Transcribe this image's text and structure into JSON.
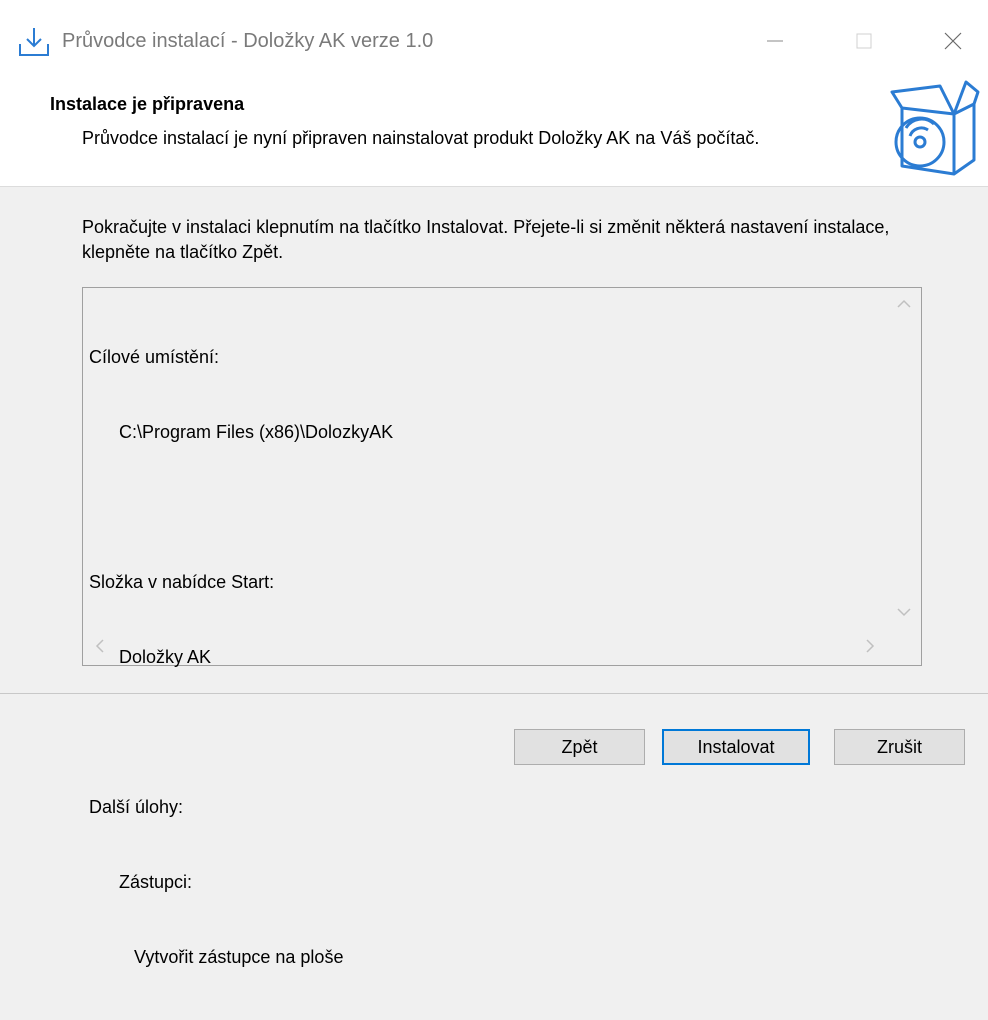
{
  "window": {
    "title": "Průvodce instalací - Doložky AK verze 1.0",
    "icons": {
      "app": "download-tray-icon",
      "minimize": "minimize-icon",
      "maximize": "maximize-icon",
      "close": "close-icon"
    }
  },
  "header": {
    "title": "Instalace je připravena",
    "description": "Průvodce instalací je nyní připraven nainstalovat produkt Doložky AK na Váš počítač.",
    "image_icon": "software-box-disc-icon"
  },
  "main": {
    "intro": "Pokračujte v instalaci klepnutím na tlačítko Instalovat. Přejete-li si změnit některá nastavení instalace, klepněte na tlačítko Zpět.",
    "memo_lines": [
      "Cílové umístění:",
      "      C:\\Program Files (x86)\\DolozkyAK",
      "",
      "Složka v nabídce Start:",
      "      Doložky AK",
      "",
      "Další úlohy:",
      "      Zástupci:",
      "         Vytvořit zástupce na ploše"
    ]
  },
  "buttons": {
    "back": "Zpět",
    "install": "Instalovat",
    "cancel": "Zrušit"
  },
  "colors": {
    "accent": "#0078d7",
    "dialog_bg": "#f0f0f0",
    "header_bg": "#ffffff"
  }
}
